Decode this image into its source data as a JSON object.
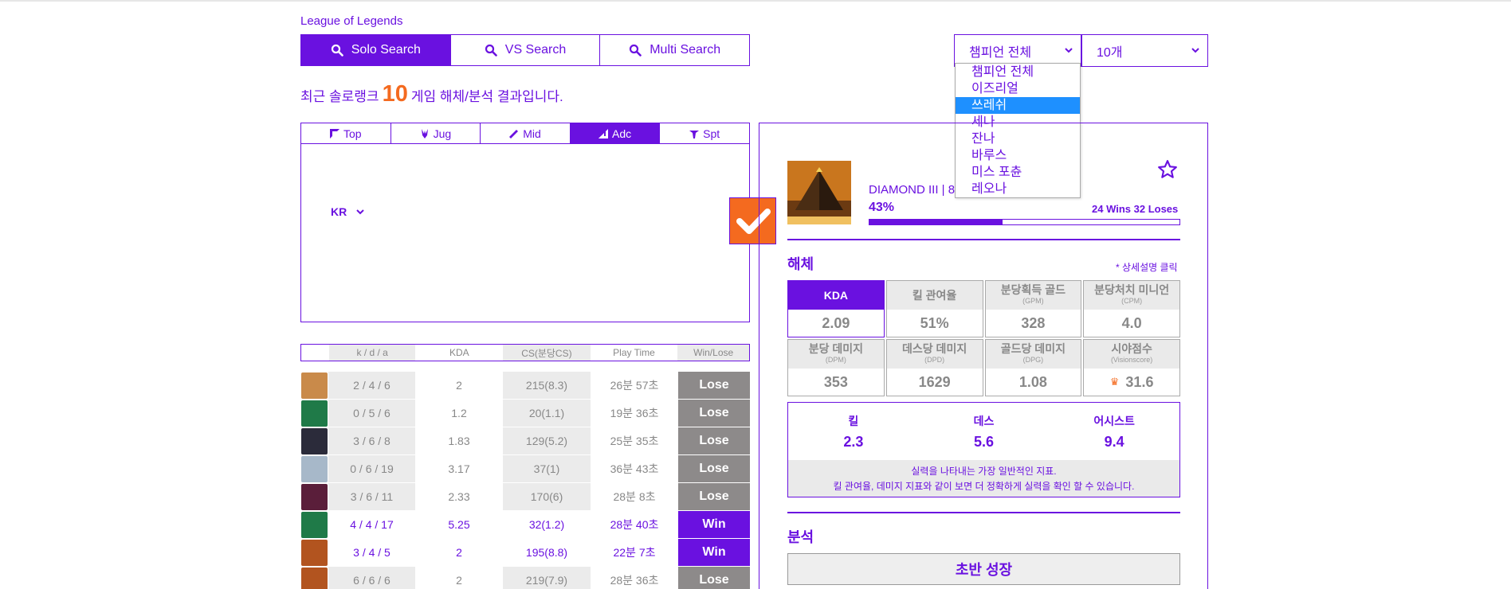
{
  "brand": "League of Legends",
  "tabs": [
    {
      "label": "Solo Search"
    },
    {
      "label": "VS Search"
    },
    {
      "label": "Multi Search"
    }
  ],
  "headline": {
    "prefix": "최근 솔로랭크",
    "count": "10",
    "suffix": "게임 해체/분석 결과입니다."
  },
  "champion_select": {
    "selected": "챔피언 전체",
    "options": [
      "챔피언 전체",
      "이즈리얼",
      "쓰레쉬",
      "세나",
      "잔나",
      "바루스",
      "미스 포츈",
      "레오나"
    ],
    "highlighted_index": 2
  },
  "count_select": {
    "selected": "10개"
  },
  "lanes": [
    {
      "label": "Top"
    },
    {
      "label": "Jug"
    },
    {
      "label": "Mid"
    },
    {
      "label": "Adc"
    },
    {
      "label": "Spt"
    }
  ],
  "region": "KR",
  "table": {
    "headers": [
      "k / d / a",
      "KDA",
      "CS(분당CS)",
      "Play Time",
      "Win/Lose"
    ],
    "rows": [
      {
        "kda_line": "2 / 4 / 6",
        "kda": "2",
        "cs": "215(8.3)",
        "time": "26분 57초",
        "result": "Lose",
        "avatar_color": "#c98a4a"
      },
      {
        "kda_line": "0 / 5 / 6",
        "kda": "1.2",
        "cs": "20(1.1)",
        "time": "19분 36초",
        "result": "Lose",
        "avatar_color": "#1f7a48"
      },
      {
        "kda_line": "3 / 6 / 8",
        "kda": "1.83",
        "cs": "129(5.2)",
        "time": "25분 35초",
        "result": "Lose",
        "avatar_color": "#2b2b3a"
      },
      {
        "kda_line": "0 / 6 / 19",
        "kda": "3.17",
        "cs": "37(1)",
        "time": "36분 43초",
        "result": "Lose",
        "avatar_color": "#a7b8c9"
      },
      {
        "kda_line": "3 / 6 / 11",
        "kda": "2.33",
        "cs": "170(6)",
        "time": "28분 8초",
        "result": "Lose",
        "avatar_color": "#5a1e3a"
      },
      {
        "kda_line": "4 / 4 / 17",
        "kda": "5.25",
        "cs": "32(1.2)",
        "time": "28분 40초",
        "result": "Win",
        "avatar_color": "#1f7a48"
      },
      {
        "kda_line": "3 / 4 / 5",
        "kda": "2",
        "cs": "195(8.8)",
        "time": "22분 7초",
        "result": "Win",
        "avatar_color": "#b2541f"
      },
      {
        "kda_line": "6 / 6 / 6",
        "kda": "2",
        "cs": "219(7.9)",
        "time": "28분 36초",
        "result": "Lose",
        "avatar_color": "#b2541f"
      }
    ]
  },
  "profile": {
    "rank": "DIAMOND III | 8",
    "winrate": "43%",
    "winrate_value": 0.43,
    "record": "24 Wins 32 Loses"
  },
  "breakdown": {
    "title": "해체",
    "detail_link": "* 상세설명 클릭",
    "stats": [
      {
        "label": "KDA",
        "sub": "",
        "value": "2.09"
      },
      {
        "label": "킬 관여율",
        "sub": "",
        "value": "51%"
      },
      {
        "label": "분당획득 골드",
        "sub": "(GPM)",
        "value": "328"
      },
      {
        "label": "분당처치 미니언",
        "sub": "(CPM)",
        "value": "4.0"
      },
      {
        "label": "분당 데미지",
        "sub": "(DPM)",
        "value": "353"
      },
      {
        "label": "데스당 데미지",
        "sub": "(DPD)",
        "value": "1629"
      },
      {
        "label": "골드당 데미지",
        "sub": "(DPG)",
        "value": "1.08"
      },
      {
        "label": "시야점수",
        "sub": "(Visionscore)",
        "value": "31.6"
      }
    ],
    "kda_detail": {
      "kill_label": "킬",
      "kill": "2.3",
      "death_label": "데스",
      "death": "5.6",
      "assist_label": "어시스트",
      "assist": "9.4",
      "note1": "실력을 나타내는 가장 일반적인 지표.",
      "note2": "킬 관여율, 데미지 지표와 같이 보면 더 정확하게 실력을 확인 할 수 있습니다."
    }
  },
  "analysis": {
    "title": "분석",
    "growth_title": "초반 성장"
  },
  "colors": {
    "accent": "#6a11e0",
    "orange": "#f46a1f",
    "lose": "#8d8a8a"
  }
}
